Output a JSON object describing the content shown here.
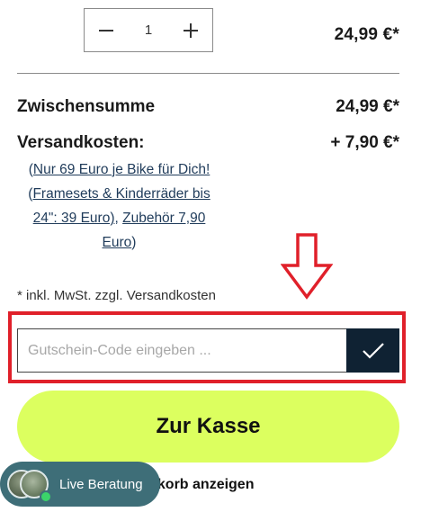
{
  "item": {
    "quantity": "1",
    "price": "24,99 €*"
  },
  "summary": {
    "subtotal_label": "Zwischensumme",
    "subtotal_value": "24,99 €*",
    "shipping_label": "Versandkosten:",
    "shipping_value": "+ 7,90 €*",
    "shipping_note": {
      "open_paren": "(",
      "link1": "Nur 69 Euro je Bike für Dich!",
      "paren_open_2": "(",
      "link2": "Framesets & Kinderräder bis 24\": 39 Euro)",
      "comma": ", ",
      "link3": "Zubehör 7,90 Euro",
      "close_paren": ")"
    },
    "tax_note": "* inkl. MwSt. zzgl. Versandkosten"
  },
  "coupon": {
    "placeholder": "Gutschein-Code eingeben ...",
    "value": ""
  },
  "checkout": {
    "label": "Zur Kasse"
  },
  "cart_link": {
    "label": "renkorb anzeigen"
  },
  "live_chat": {
    "label": "Live Beratung"
  },
  "colors": {
    "highlight": "#e0202a",
    "checkout_bg": "#dcff5f",
    "submit_bg": "#0f2233",
    "live_pill_bg": "#3e6e78",
    "link_color": "#1f3b5a"
  },
  "icons": [
    "minus-icon",
    "plus-icon",
    "checkmark-icon",
    "down-arrow-annotation-icon",
    "avatar-icon",
    "online-status-icon"
  ]
}
